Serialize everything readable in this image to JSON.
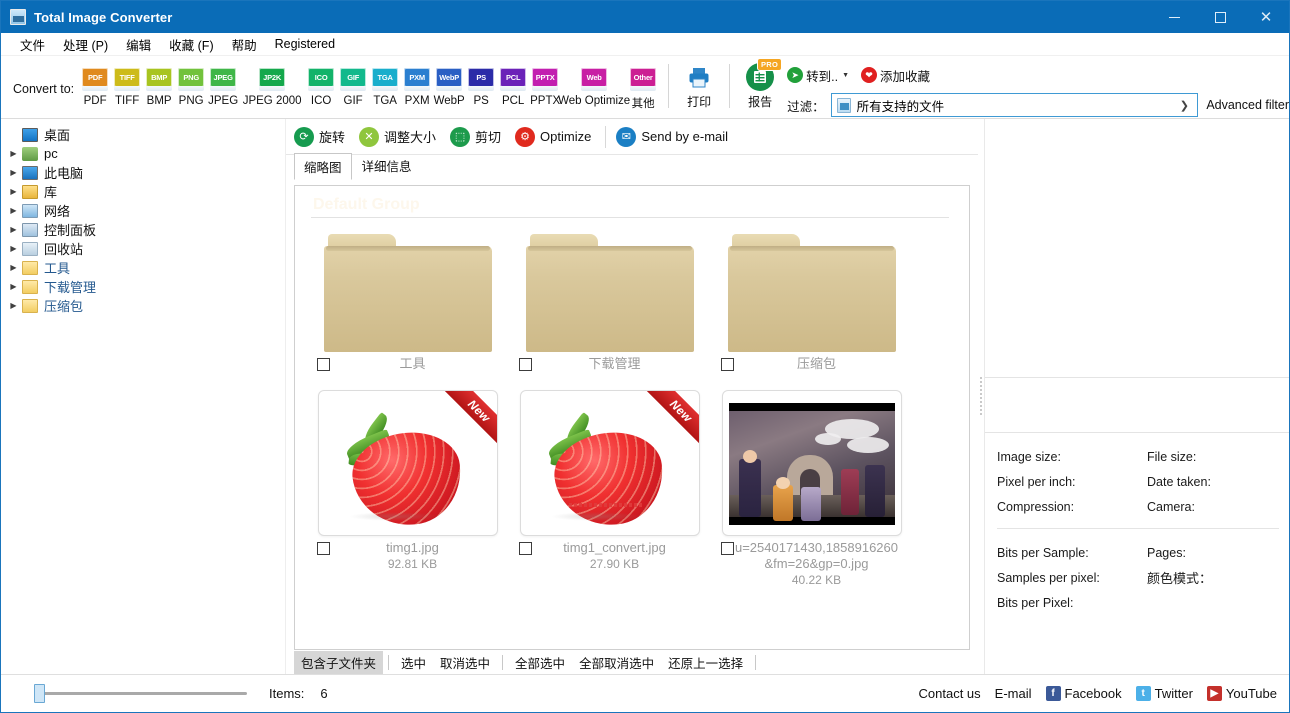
{
  "window": {
    "title": "Total Image Converter",
    "app_icon": "image-converter-icon",
    "minimize": "—",
    "maximize": "□",
    "close": "✕"
  },
  "menubar": {
    "items": [
      {
        "label": "文件"
      },
      {
        "label": "处理 (P)"
      },
      {
        "label": "编辑"
      },
      {
        "label": "收藏 (F)"
      },
      {
        "label": "帮助"
      },
      {
        "label": "Registered"
      }
    ]
  },
  "toolbar": {
    "convert_label": "Convert to:",
    "formats": [
      {
        "label": "PDF",
        "badge": "PDF",
        "color": "#e08a1e"
      },
      {
        "label": "TIFF",
        "badge": "TIFF",
        "color": "#cdbb1a"
      },
      {
        "label": "BMP",
        "badge": "BMP",
        "color": "#a8c420"
      },
      {
        "label": "PNG",
        "badge": "PNG",
        "color": "#72c23c"
      },
      {
        "label": "JPEG",
        "badge": "JPEG",
        "color": "#3fb648"
      },
      {
        "label": "JPEG 2000",
        "badge": "JP2K",
        "color": "#14a84c",
        "wide": true
      },
      {
        "label": "ICO",
        "badge": "ICO",
        "color": "#13b36a"
      },
      {
        "label": "GIF",
        "badge": "GIF",
        "color": "#12b98c"
      },
      {
        "label": "TGA",
        "badge": "TGA",
        "color": "#19aecc"
      },
      {
        "label": "PXM",
        "badge": "PXM",
        "color": "#2b7fd0"
      },
      {
        "label": "WebP",
        "badge": "WebP",
        "color": "#2a5fc4"
      },
      {
        "label": "PS",
        "badge": "PS",
        "color": "#2b2ba8"
      },
      {
        "label": "PCL",
        "badge": "PCL",
        "color": "#6b22b8"
      },
      {
        "label": "PPTX",
        "badge": "PPTX",
        "color": "#c21fb0"
      },
      {
        "label": "Web Optimize",
        "badge": "Web",
        "color": "#c81fa4",
        "wide": true
      },
      {
        "label": "其他",
        "badge": "Other",
        "color": "#cc1f93",
        "has_caret": true
      }
    ],
    "print": {
      "label": "打印",
      "icon": "printer-icon",
      "color": "#1f7ec4"
    },
    "report": {
      "label": "报告",
      "icon": "report-icon",
      "color": "#159049",
      "badge": "PRO",
      "badge_color": "#f5a623"
    },
    "goto": {
      "label": "转到..",
      "icon": "goto-arrow-icon",
      "color": "#21a03a"
    },
    "favorite": {
      "label": "添加收藏",
      "icon": "heart-icon",
      "color": "#e02020"
    },
    "filter_label": "过滤：",
    "filter_value": "所有支持的文件",
    "filter_icon": "file-type-icon",
    "advanced_filter": "Advanced filter"
  },
  "sidebar": {
    "items": [
      {
        "label": "桌面",
        "icon": "desktop-icon",
        "icon_class": "ic-desktop",
        "expandable": false,
        "style": "black"
      },
      {
        "label": "pc",
        "icon": "user-icon",
        "icon_class": "ic-user",
        "expandable": true,
        "style": "black"
      },
      {
        "label": "此电脑",
        "icon": "this-pc-icon",
        "icon_class": "ic-pc",
        "expandable": true,
        "style": "black"
      },
      {
        "label": "库",
        "icon": "libraries-icon",
        "icon_class": "ic-lib",
        "expandable": true,
        "style": "black"
      },
      {
        "label": "网络",
        "icon": "network-icon",
        "icon_class": "ic-net",
        "expandable": true,
        "style": "black"
      },
      {
        "label": "控制面板",
        "icon": "control-panel-icon",
        "icon_class": "ic-cpanel",
        "expandable": true,
        "style": "black"
      },
      {
        "label": "回收站",
        "icon": "recycle-bin-icon",
        "icon_class": "ic-bin",
        "expandable": true,
        "style": "black"
      },
      {
        "label": "工具",
        "icon": "folder-icon",
        "icon_class": "ic-folder",
        "expandable": true,
        "style": "blue"
      },
      {
        "label": "下载管理",
        "icon": "folder-icon",
        "icon_class": "ic-folder",
        "expandable": true,
        "style": "blue"
      },
      {
        "label": "压缩包",
        "icon": "folder-icon",
        "icon_class": "ic-folder",
        "expandable": true,
        "style": "blue"
      }
    ]
  },
  "ops": {
    "buttons": [
      {
        "label": "旋转",
        "icon": "rotate-icon",
        "color": "#169b4f",
        "glyph": "⟳"
      },
      {
        "label": "调整大小",
        "icon": "resize-icon",
        "color": "#8fc63d",
        "glyph": "✕"
      },
      {
        "label": "剪切",
        "icon": "crop-icon",
        "color": "#1d9b4c",
        "glyph": "⬚"
      },
      {
        "label": "Optimize",
        "icon": "optimize-icon",
        "color": "#e02a1e",
        "glyph": "⚙"
      },
      {
        "label": "Send by e-mail",
        "icon": "email-icon",
        "color": "#1b7fc4",
        "glyph": "✉"
      }
    ]
  },
  "tabs": {
    "items": [
      {
        "label": "缩略图",
        "active": true
      },
      {
        "label": "详细信息",
        "active": false
      }
    ]
  },
  "filelist": {
    "group_title": "Default Group",
    "rows": [
      [
        {
          "type": "folder",
          "name": "工具",
          "size": "",
          "checked": false
        },
        {
          "type": "folder",
          "name": "下载管理",
          "size": "",
          "checked": false
        },
        {
          "type": "folder",
          "name": "压缩包",
          "size": "",
          "checked": false
        }
      ],
      [
        {
          "type": "image-strawberry",
          "name": "timg1.jpg",
          "size": "92.81 KB",
          "checked": false,
          "ribbon": "New"
        },
        {
          "type": "image-strawberry",
          "name": "timg1_convert.jpg",
          "size": "27.90 KB",
          "checked": false,
          "ribbon": "New"
        },
        {
          "type": "image-anime",
          "name": "u=2540171430,1858916260&fm=26&gp=0.jpg",
          "size": "40.22 KB",
          "checked": false,
          "ribbon": ""
        }
      ]
    ]
  },
  "selection_bar": {
    "buttons": [
      {
        "label": "包含子文件夹",
        "active": true,
        "sep_after": true
      },
      {
        "label": "选中",
        "active": false,
        "sep_after": false
      },
      {
        "label": "取消选中",
        "active": false,
        "sep_after": true
      },
      {
        "label": "全部选中",
        "active": false,
        "sep_after": false
      },
      {
        "label": "全部取消选中",
        "active": false,
        "sep_after": false
      },
      {
        "label": "还原上一选择",
        "active": false,
        "sep_after": true
      }
    ]
  },
  "properties": {
    "left": [
      "Image size:",
      "Pixel per inch:",
      "Compression:"
    ],
    "right": [
      "File size:",
      "Date taken:",
      "Camera:"
    ],
    "left2": [
      "Bits per Sample:",
      "Samples per pixel:",
      "Bits per Pixel:"
    ],
    "right2": [
      "Pages:",
      "颜色模式："
    ]
  },
  "statusbar": {
    "items_label": "Items:",
    "items_value": "6",
    "contact": "Contact us",
    "links": [
      {
        "label": "E-mail",
        "icon": "email-icon",
        "color": "",
        "glyph": ""
      },
      {
        "label": "Facebook",
        "icon": "facebook-icon",
        "color": "#3b5998",
        "glyph": "f"
      },
      {
        "label": "Twitter",
        "icon": "twitter-icon",
        "color": "#4cb0e8",
        "glyph": "t"
      },
      {
        "label": "YouTube",
        "icon": "youtube-icon",
        "color": "#c4302b",
        "glyph": "▶"
      }
    ]
  }
}
